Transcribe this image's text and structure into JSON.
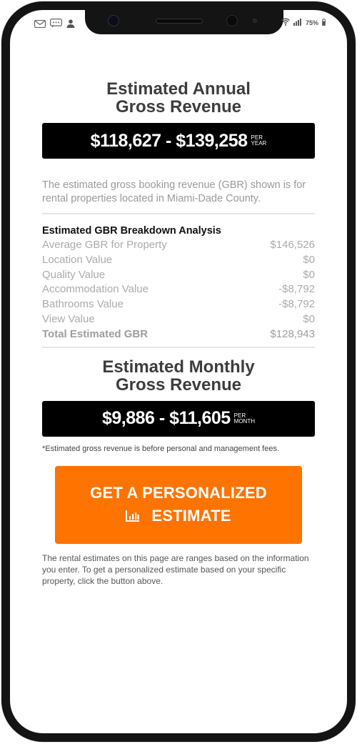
{
  "status_bar": {
    "left_icons": [
      "mail-icon",
      "message-icon",
      "user-icon"
    ],
    "battery_percent": "75%",
    "right_icons": [
      "wifi-icon",
      "signal-icon",
      "battery-icon"
    ]
  },
  "annual": {
    "heading_line1": "Estimated Annual",
    "heading_line2": "Gross Revenue",
    "range": "$118,627 - $139,258",
    "per_line1": "PER",
    "per_line2": "YEAR"
  },
  "intro_text": "The estimated gross booking revenue (GBR) shown is for rental properties located in Miami-Dade County.",
  "breakdown": {
    "title": "Estimated GBR Breakdown Analysis",
    "rows": [
      {
        "label": "Average GBR for Property",
        "value": "$146,526"
      },
      {
        "label": "Location Value",
        "value": "$0"
      },
      {
        "label": "Quality Value",
        "value": "$0"
      },
      {
        "label": "Accommodation Value",
        "value": "-$8,792"
      },
      {
        "label": "Bathrooms Value",
        "value": "-$8,792"
      },
      {
        "label": "View Value",
        "value": "$0"
      }
    ],
    "total": {
      "label": "Total Estimated GBR",
      "value": "$128,943"
    }
  },
  "monthly": {
    "heading_line1": "Estimated Monthly",
    "heading_line2": "Gross Revenue",
    "range": "$9,886 - $11,605",
    "per_line1": "PER",
    "per_line2": "MONTH"
  },
  "footnote": "*Estimated gross revenue is before personal and management fees.",
  "cta": {
    "line1": "GET A PERSONALIZED",
    "line2": "ESTIMATE",
    "icon": "bar-chart-icon",
    "color": "#ff7300"
  },
  "disclaimer": "The rental estimates on this page are ranges based on the information you enter. To get a personalized estimate based on your specific property, click the button above."
}
